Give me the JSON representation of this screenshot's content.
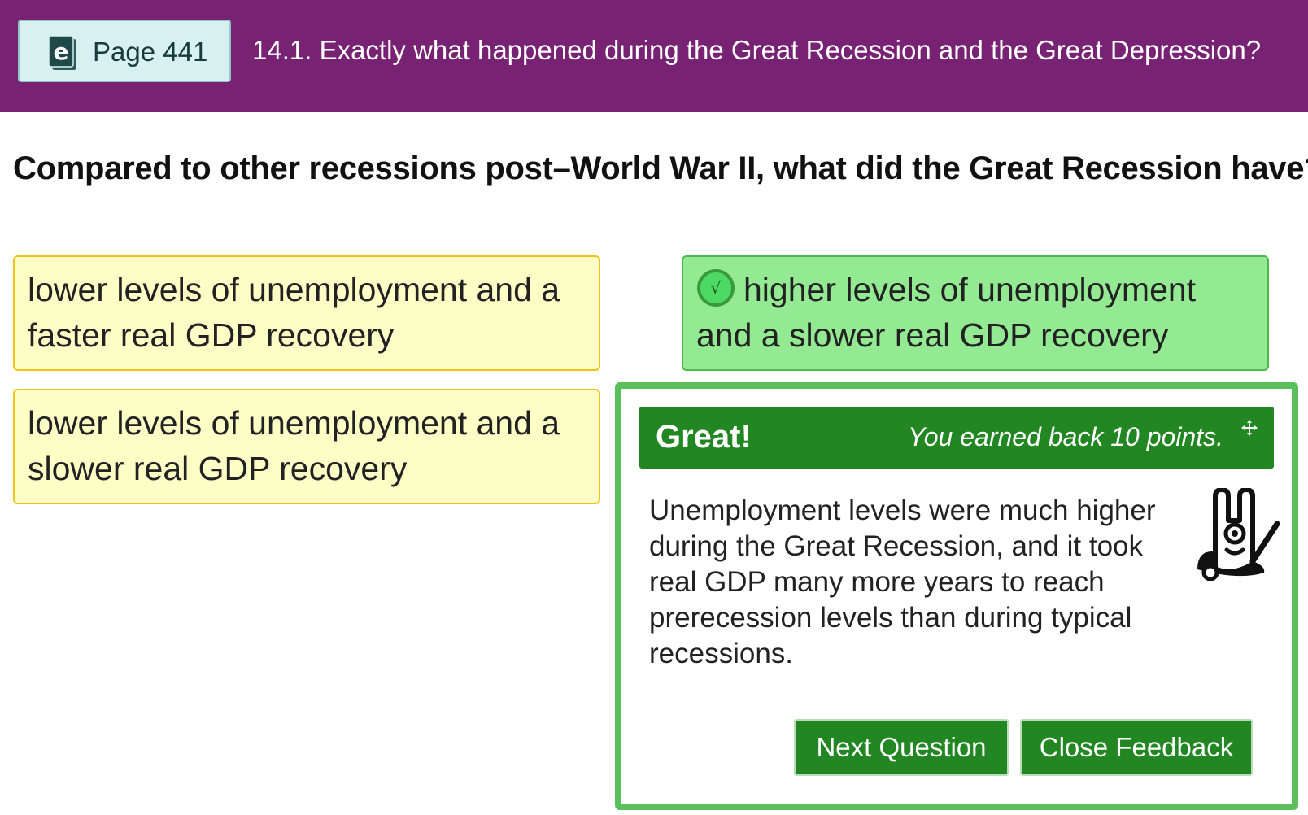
{
  "header": {
    "page_label": "Page 441",
    "section_title": "14.1. Exactly what happened during the Great Recession and the Great Depression?",
    "background_color": "#782273",
    "ebook_icon": "ebook-icon"
  },
  "question": {
    "text": "Compared to other recessions post–World War II, what did the Great Recession have?"
  },
  "answers": [
    {
      "text": "lower levels of unemployment and a faster real GDP recovery",
      "state": "incorrect"
    },
    {
      "text": "higher levels of unemployment and a slower real GDP recovery",
      "state": "correct",
      "icon": "check-circle-icon"
    },
    {
      "text": "lower levels of unemployment and a slower real GDP recovery",
      "state": "incorrect"
    }
  ],
  "feedback": {
    "title": "Great!",
    "points_message": "You earned back 10 points.",
    "body": "Unemployment levels were much higher during the Great Recession, and it took real GDP many more years to reach prerecession levels than during typical recessions.",
    "mascot_icon": "mascot-icon",
    "move_icon": "move-icon",
    "next_button": "Next Question",
    "close_button": "Close Feedback",
    "accent_color": "#228722"
  }
}
